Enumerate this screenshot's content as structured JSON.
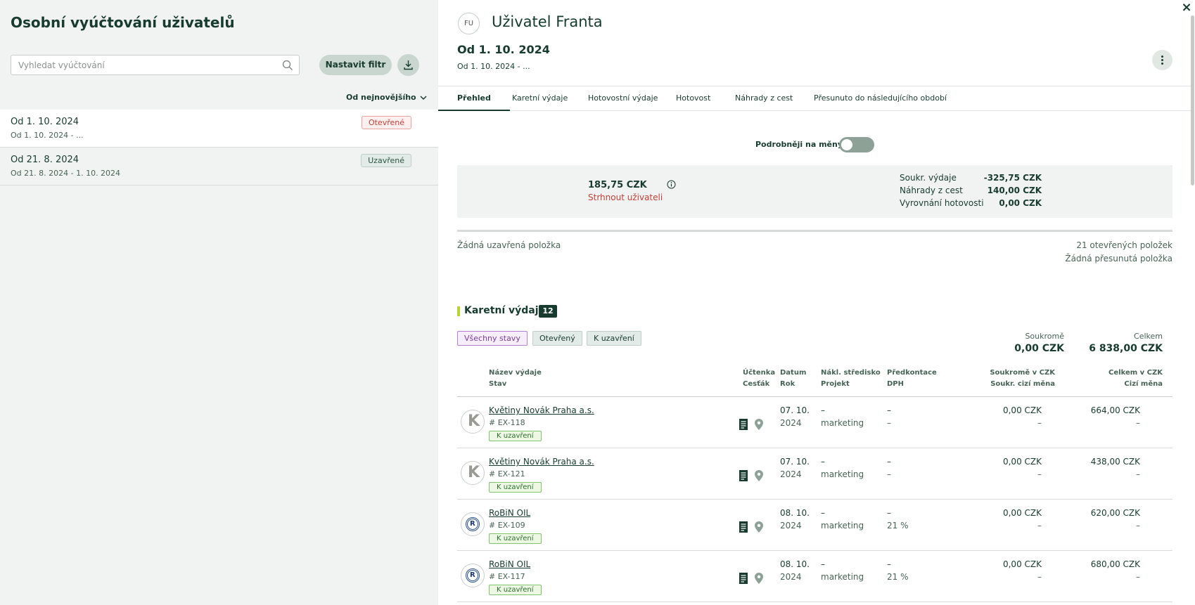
{
  "left": {
    "title": "Osobní vyúčtování uživatelů",
    "search_placeholder": "Vyhledat vyúčtování",
    "filter_label": "Nastavit filtr",
    "sort_label": "Od nejnovějšího",
    "periods": [
      {
        "title": "Od 1. 10. 2024",
        "range": "Od 1. 10. 2024 - ...",
        "status": "Otevřené"
      },
      {
        "title": "Od 21. 8. 2024",
        "range": "Od 21. 8. 2024 - 1. 10. 2024",
        "status": "Uzavřené"
      }
    ]
  },
  "right": {
    "avatar_initials": "FU",
    "user_name": "Uživatel Franta",
    "close_icon": "×",
    "period_title": "Od 1. 10. 2024",
    "period_range": "Od 1. 10. 2024 - ...",
    "tabs": [
      "Přehled",
      "Karetní výdaje",
      "Hotovostní výdaje",
      "Hotovost",
      "Náhrady z cest",
      "Přesunuto do následujícího období"
    ],
    "currency_toggle_label": "Podrobněji na měny",
    "currency_toggle_on": false,
    "summary": {
      "amount": "185,75 CZK",
      "action": "Strhnout uživateli",
      "lines": [
        {
          "label": "Soukr. výdaje",
          "value": "-325,75 CZK"
        },
        {
          "label": "Náhrady z cest",
          "value": "140,00 CZK"
        },
        {
          "label": "Vyrovnání hotovosti",
          "value": "0,00 CZK"
        }
      ],
      "no_closed": "Žádná uzavřená položka",
      "open_items": "21 otevřených položek",
      "no_moved": "Žádná přesunutá položka"
    },
    "card_section": {
      "title": "Karetní výdaje",
      "count": "12",
      "filters": [
        "Všechny stavy",
        "Otevřený",
        "K uzavření"
      ],
      "private_label": "Soukromě",
      "private_total": "0,00 CZK",
      "total_label": "Celkem",
      "total": "6 838,00 CZK",
      "headers": {
        "name": "Název výdaje",
        "state": "Stav",
        "receipt": "Účtenka",
        "travel": "Cesťák",
        "date": "Datum",
        "year": "Rok",
        "cost_center": "Nákl. středisko",
        "project": "Projekt",
        "precontact": "Předkontace",
        "vat": "DPH",
        "private_czk": "Soukromě v CZK",
        "private_foreign": "Soukr. cizí měna",
        "total_czk": "Celkem v CZK",
        "foreign": "Cizí měna"
      },
      "rows": [
        {
          "logo": "K",
          "logo_type": "k",
          "name": "Květiny Novák Praha a.s.",
          "id": "EX-118",
          "state": "K uzavření",
          "date": "07. 10.",
          "year": "2024",
          "cost_center": "–",
          "project": "marketing",
          "precontact": "–",
          "vat": "–",
          "private": "0,00 CZK",
          "private_foreign": "–",
          "total": "664,00 CZK",
          "foreign": "–"
        },
        {
          "logo": "K",
          "logo_type": "k",
          "name": "Květiny Novák Praha a.s.",
          "id": "EX-121",
          "state": "K uzavření",
          "date": "07. 10.",
          "year": "2024",
          "cost_center": "–",
          "project": "marketing",
          "precontact": "–",
          "vat": "–",
          "private": "0,00 CZK",
          "private_foreign": "–",
          "total": "438,00 CZK",
          "foreign": "–"
        },
        {
          "logo": "R",
          "logo_type": "r",
          "name": "RoBiN OIL",
          "id": "EX-109",
          "state": "K uzavření",
          "date": "08. 10.",
          "year": "2024",
          "cost_center": "–",
          "project": "marketing",
          "precontact": "–",
          "vat": "21 %",
          "private": "0,00 CZK",
          "private_foreign": "–",
          "total": "620,00 CZK",
          "foreign": "–"
        },
        {
          "logo": "R",
          "logo_type": "r",
          "name": "RoBiN OIL",
          "id": "EX-117",
          "state": "K uzavření",
          "date": "08. 10.",
          "year": "2024",
          "cost_center": "–",
          "project": "marketing",
          "precontact": "–",
          "vat": "21 %",
          "private": "0,00 CZK",
          "private_foreign": "–",
          "total": "680,00 CZK",
          "foreign": "–"
        }
      ]
    },
    "colors": {
      "primary": "#173b2e",
      "left_bg": "#f1f3f2",
      "open_badge": "#c23f35",
      "accent_bar": "#b7d334",
      "close_badge": "#7fc36a"
    }
  }
}
